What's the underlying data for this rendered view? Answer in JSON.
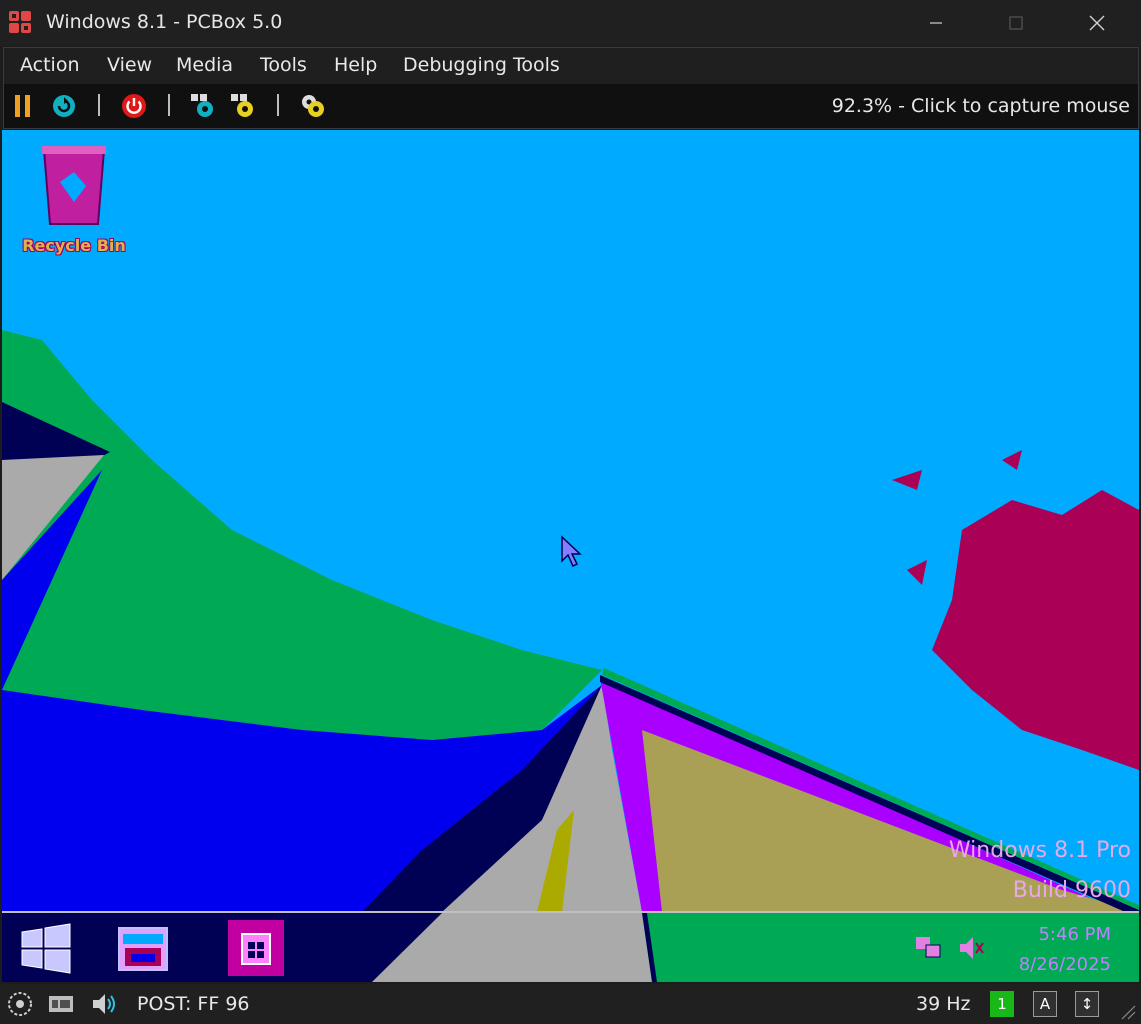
{
  "window": {
    "title": "Windows 8.1 - PCBox 5.0",
    "app_icon": "pcbox-logo-icon",
    "controls": [
      "minimize-icon",
      "maximize-icon",
      "close-icon"
    ]
  },
  "menu": {
    "items": [
      {
        "label": "Action"
      },
      {
        "label": "View"
      },
      {
        "label": "Media"
      },
      {
        "label": "Tools"
      },
      {
        "label": "Help"
      },
      {
        "label": "Debugging Tools"
      }
    ]
  },
  "toolbar": {
    "icons": [
      "pause-icon",
      "reset-icon",
      "power-icon",
      "ctrl-alt-del-icon",
      "ctrl-alt-esc-icon",
      "settings-icon"
    ],
    "capture_status": "92.3% - Click to capture mouse"
  },
  "guest": {
    "desktop": {
      "recycle_bin_label": "Recycle Bin",
      "watermark_line1": "Windows 8.1 Pro",
      "watermark_line2": "Build 9600"
    },
    "taskbar": {
      "icons": [
        "start-icon",
        "file-explorer-icon",
        "store-icon"
      ],
      "tray_icons": [
        "network-icon",
        "volume-icon"
      ],
      "clock_time": "5:46 PM",
      "clock_date": "8/26/2025"
    },
    "colors": {
      "sky": "#00aaff",
      "green": "#00aa55",
      "blue": "#0000ee",
      "navy": "#000055",
      "gray": "#aaaaaa",
      "olive": "#aaa055",
      "purple": "#aa00ff",
      "maroon": "#aa0055"
    }
  },
  "status_bar": {
    "icons": [
      "hard-disk-icon",
      "network-card-icon",
      "sound-icon"
    ],
    "post_code": "POST: FF 96",
    "refresh_rate": "39 Hz",
    "indicators": [
      "1",
      "A",
      "↕"
    ]
  }
}
